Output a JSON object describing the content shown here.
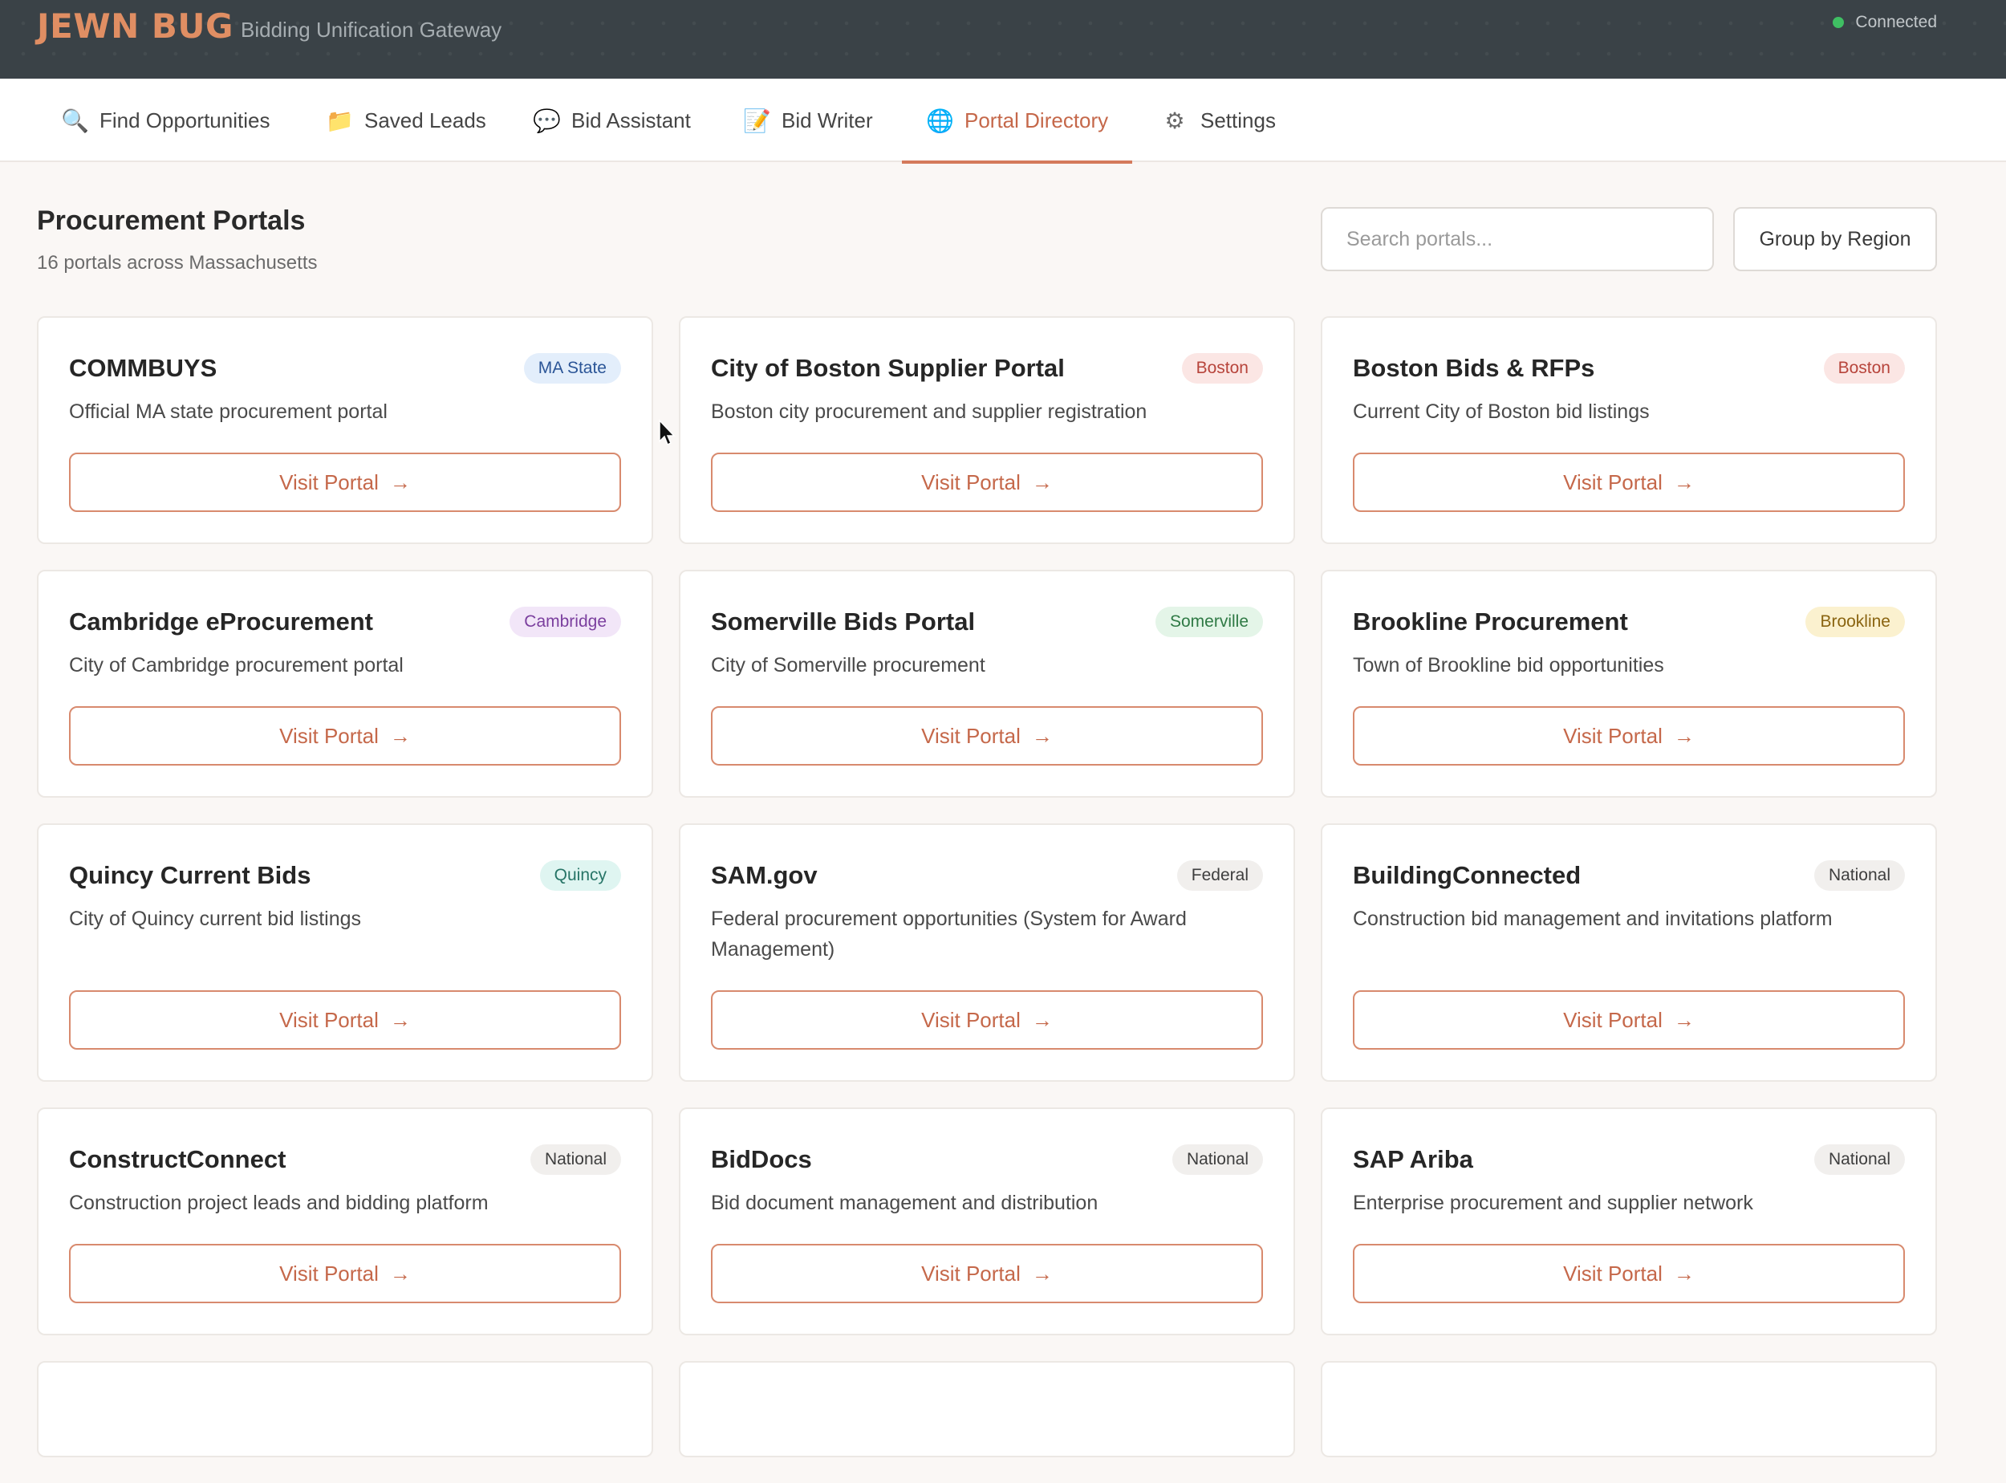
{
  "header": {
    "logo": "JEWN BUG",
    "tagline": "Bidding Unification Gateway",
    "status": "Connected",
    "status_color": "#3fbf63"
  },
  "nav": {
    "tabs": [
      {
        "label": "Find Opportunities",
        "icon": "magnifier-icon"
      },
      {
        "label": "Saved Leads",
        "icon": "folder-icon"
      },
      {
        "label": "Bid Assistant",
        "icon": "chat-bubble-icon"
      },
      {
        "label": "Bid Writer",
        "icon": "memo-icon"
      },
      {
        "label": "Portal Directory",
        "icon": "globe-icon",
        "active": true
      },
      {
        "label": "Settings",
        "icon": "gear-icon"
      }
    ]
  },
  "page": {
    "title": "Procurement Portals",
    "subtitle": "16 portals across Massachusetts",
    "search_placeholder": "Search portals...",
    "group_label": "Group by Region"
  },
  "visit_label": "Visit Portal",
  "portals": [
    {
      "name": "COMMBUYS",
      "region": "MA State",
      "desc": "Official MA state procurement portal",
      "badge_bg": "#e3eefb",
      "badge_fg": "#2b5597"
    },
    {
      "name": "City of Boston Supplier Portal",
      "region": "Boston",
      "desc": "Boston city procurement and supplier registration",
      "badge_bg": "#fbe6e4",
      "badge_fg": "#b7443b"
    },
    {
      "name": "Boston Bids & RFPs",
      "region": "Boston",
      "desc": "Current City of Boston bid listings",
      "badge_bg": "#fbe6e4",
      "badge_fg": "#b7443b"
    },
    {
      "name": "Cambridge eProcurement",
      "region": "Cambridge",
      "desc": "City of Cambridge procurement portal",
      "badge_bg": "#f2e6f8",
      "badge_fg": "#7b3f9e"
    },
    {
      "name": "Somerville Bids Portal",
      "region": "Somerville",
      "desc": "City of Somerville procurement",
      "badge_bg": "#e4f5e8",
      "badge_fg": "#2f7a45"
    },
    {
      "name": "Brookline Procurement",
      "region": "Brookline",
      "desc": "Town of Brookline bid opportunities",
      "badge_bg": "#fbf1cf",
      "badge_fg": "#8a6410"
    },
    {
      "name": "Quincy Current Bids",
      "region": "Quincy",
      "desc": "City of Quincy current bid listings",
      "badge_bg": "#dff5f1",
      "badge_fg": "#277567"
    },
    {
      "name": "SAM.gov",
      "region": "Federal",
      "desc": "Federal procurement opportunities (System for Award Management)",
      "badge_bg": "#f1efed",
      "badge_fg": "#3e3e3e"
    },
    {
      "name": "BuildingConnected",
      "region": "National",
      "desc": "Construction bid management and invitations platform",
      "badge_bg": "#f1efed",
      "badge_fg": "#3e3e3e"
    },
    {
      "name": "ConstructConnect",
      "region": "National",
      "desc": "Construction project leads and bidding platform",
      "badge_bg": "#f1efed",
      "badge_fg": "#3e3e3e"
    },
    {
      "name": "BidDocs",
      "region": "National",
      "desc": "Bid document management and distribution",
      "badge_bg": "#f1efed",
      "badge_fg": "#3e3e3e"
    },
    {
      "name": "SAP Ariba",
      "region": "National",
      "desc": "Enterprise procurement and supplier network",
      "badge_bg": "#f1efed",
      "badge_fg": "#3e3e3e"
    }
  ]
}
